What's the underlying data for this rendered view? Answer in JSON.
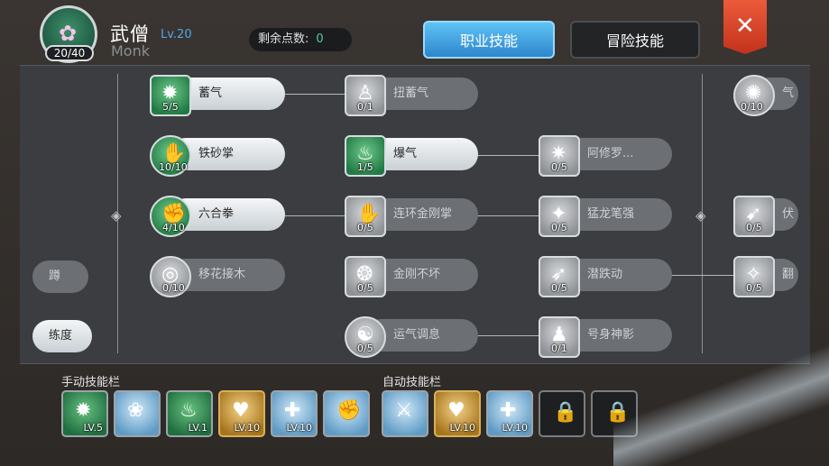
{
  "header": {
    "class_name": "武僧",
    "class_level": "Lv.20",
    "class_name_en": "Monk",
    "level_progress": "20/40",
    "points_label": "剩余点数:",
    "points_value": "0",
    "avatar_icon": "monk-portrait-icon"
  },
  "tabs": [
    {
      "label": "职业技能",
      "active": true
    },
    {
      "label": "冒险技能",
      "active": false
    }
  ],
  "close_label": "✕",
  "skills": [
    {
      "name": "蓄气",
      "level": "5/5",
      "active": true,
      "icon": "sunburst-icon"
    },
    {
      "name": "铁砂掌",
      "level": "10/10",
      "active": true,
      "icon": "palm-icon"
    },
    {
      "name": "六合拳",
      "level": "4/10",
      "active": true,
      "icon": "fist-icon"
    },
    {
      "name": "移花接木",
      "level": "0/10",
      "active": false,
      "icon": "swirl-icon"
    },
    {
      "name": "扭蓄气",
      "level": "0/1",
      "active": false,
      "icon": "figure-icon"
    },
    {
      "name": "爆气",
      "level": "1/5",
      "active": true,
      "icon": "flame-figure-icon"
    },
    {
      "name": "连环金刚掌",
      "level": "0/5",
      "active": false,
      "icon": "combo-palm-icon"
    },
    {
      "name": "金刚不坏",
      "level": "0/5",
      "active": false,
      "icon": "shield-aura-icon"
    },
    {
      "name": "运气调息",
      "level": "0/5",
      "active": false,
      "icon": "meditate-icon"
    },
    {
      "name": "阿修罗...",
      "level": "0/5",
      "active": false,
      "icon": "asura-icon"
    },
    {
      "name": "猛龙笔强",
      "level": "0/5",
      "active": false,
      "icon": "dragon-icon"
    },
    {
      "name": "潜跌动",
      "level": "0/5",
      "active": false,
      "icon": "dash-icon"
    },
    {
      "name": "号身神影",
      "level": "0/1",
      "active": false,
      "icon": "shadow-icon"
    },
    {
      "name": "气",
      "level": "0/10",
      "active": false,
      "icon": "burst-icon"
    },
    {
      "name": "伏",
      "level": "0/5",
      "active": false,
      "icon": "bow-icon"
    },
    {
      "name": "翻",
      "level": "0/5",
      "active": false,
      "icon": "strike-icon"
    },
    {
      "name": "蹲",
      "level": "",
      "active": false,
      "icon": ""
    },
    {
      "name": "练度",
      "level": "",
      "active": false,
      "icon": ""
    }
  ],
  "manual_bar": {
    "label": "手动技能栏",
    "slots": [
      {
        "lv": "LV.5",
        "icon": "sunburst-icon"
      },
      {
        "lv": "",
        "icon": "lotus-icon"
      },
      {
        "lv": "LV.1",
        "icon": "flame-figure-icon"
      },
      {
        "lv": "LV.10",
        "icon": "heal-heart-icon"
      },
      {
        "lv": "LV.10",
        "icon": "cross-shield-icon"
      },
      {
        "lv": "",
        "icon": "fist-icon"
      }
    ]
  },
  "auto_bar": {
    "label": "自动技能栏",
    "slots": [
      {
        "lv": "",
        "icon": "sword-burst-icon"
      },
      {
        "lv": "LV.10",
        "icon": "heal-heart-icon"
      },
      {
        "lv": "LV.10",
        "icon": "cross-shield-icon"
      },
      {
        "lv": "",
        "icon": "lock-icon"
      },
      {
        "lv": "",
        "icon": "lock-icon"
      }
    ]
  }
}
